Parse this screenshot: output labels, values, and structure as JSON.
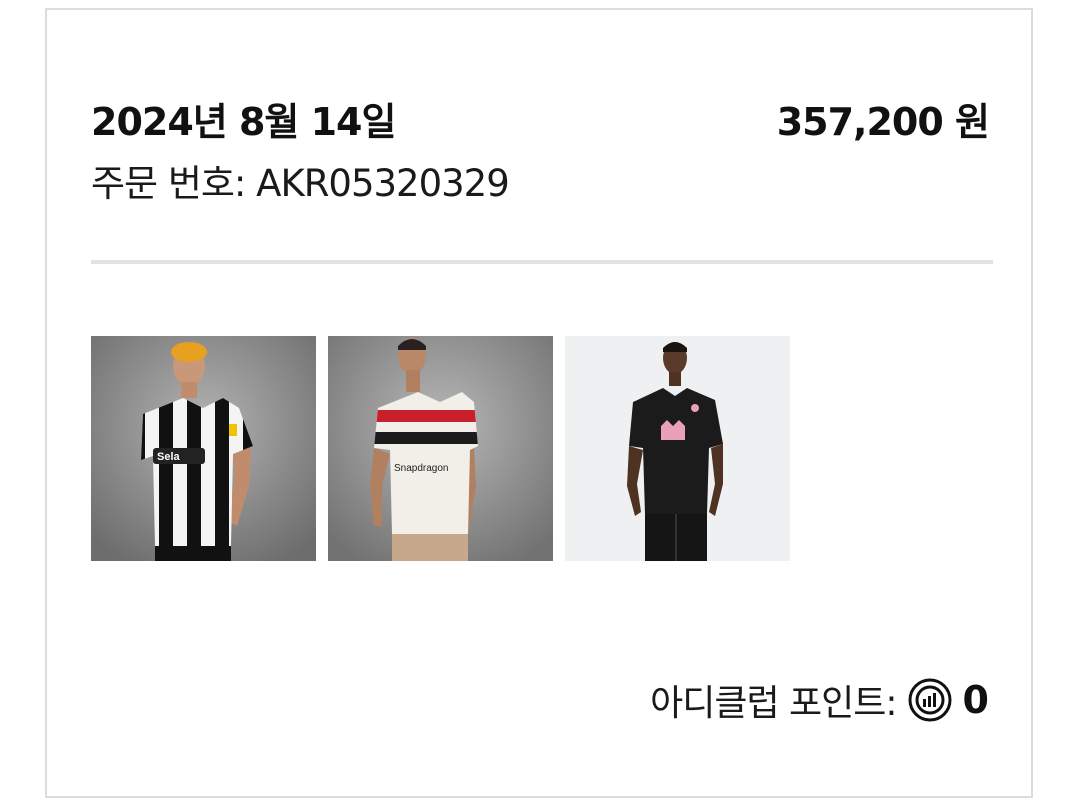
{
  "order": {
    "date": "2024년 8월 14일",
    "total": "357,200 원",
    "number_label": "주문 번호: AKR05320329"
  },
  "products": [
    {
      "name": "newcastle-home-jersey",
      "background": "#8a8a8a"
    },
    {
      "name": "manchester-united-third-jersey",
      "background": "#8c8c8c"
    },
    {
      "name": "inter-miami-away-jersey",
      "background": "#eef0f2"
    }
  ],
  "points": {
    "label": "아디클럽 포인트:",
    "icon": "adiclub-points-icon",
    "value": "0"
  }
}
